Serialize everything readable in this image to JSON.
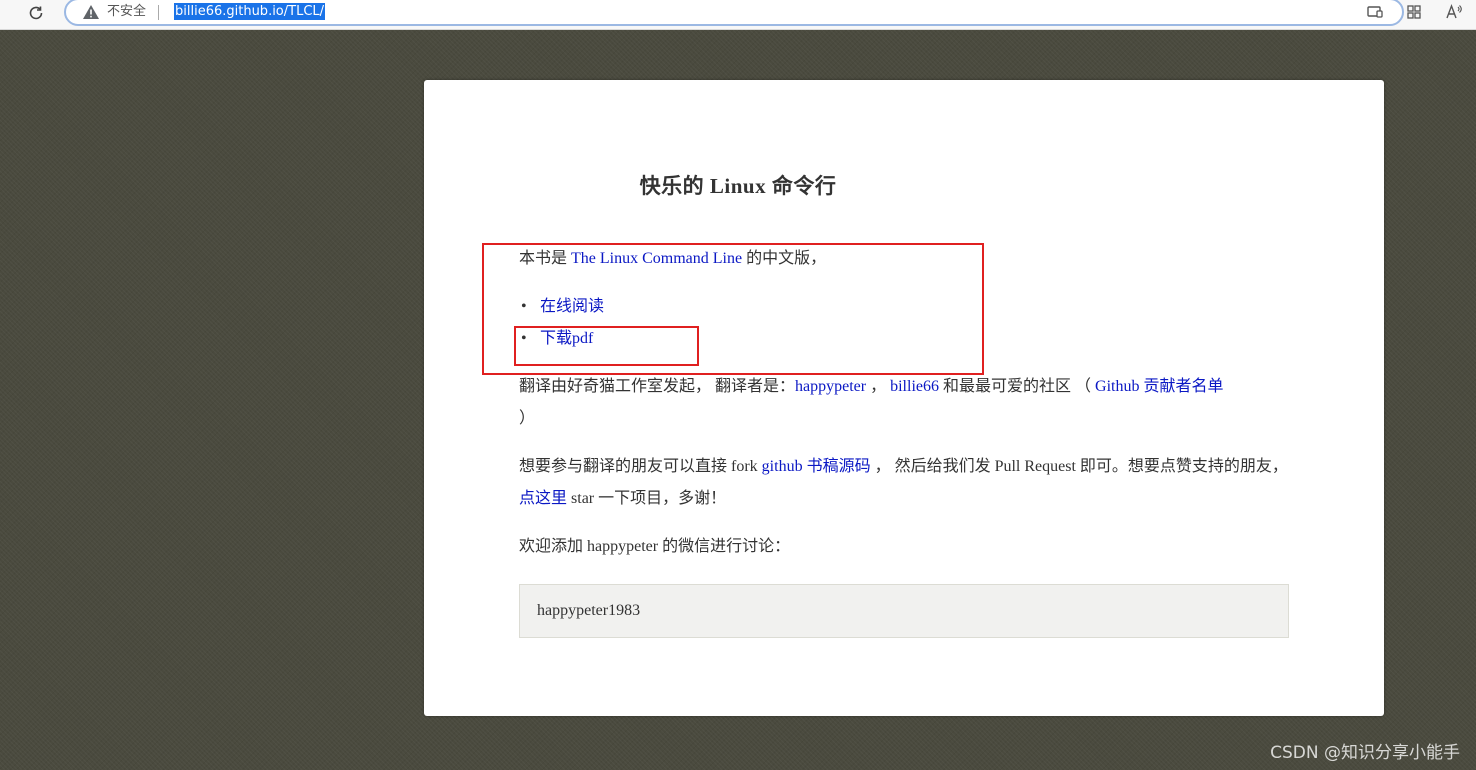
{
  "browser": {
    "security_label": "不安全",
    "url": "billie66.github.io/TLCL/"
  },
  "page": {
    "title": "快乐的 Linux 命令行",
    "intro": {
      "prefix": "本书是 ",
      "link": "The Linux Command Line",
      "suffix": " 的中文版，"
    },
    "links": [
      "在线阅读",
      "下载pdf"
    ],
    "credits": {
      "prefix": "翻译由好奇猫工作室发起， 翻译者是：",
      "link1": "happypeter",
      "mid1": " ， ",
      "link2": "billie66",
      "mid2": " 和最最可爱的社区 （ ",
      "link3": "Github 贡献者名单",
      "suffix": "）"
    },
    "contribute": {
      "prefix": "想要参与翻译的朋友可以直接 fork ",
      "link1": "github 书稿源码",
      "mid": " ， 然后给我们发 Pull Request 即可。想要点赞支持的朋友，",
      "link2": "点这里",
      "suffix": " star 一下项目，多谢！"
    },
    "wechat_text": "欢迎添加 happypeter 的微信进行讨论：",
    "wechat_id": "happypeter1983"
  },
  "watermark": "CSDN @知识分享小能手",
  "colors": {
    "link": "#0b18c4",
    "annotation": "#e02020",
    "url_highlight": "#1a73e8"
  },
  "icons": [
    "reload-icon",
    "warning-icon",
    "screen-cast-icon",
    "extensions-icon",
    "read-aloud-icon"
  ]
}
